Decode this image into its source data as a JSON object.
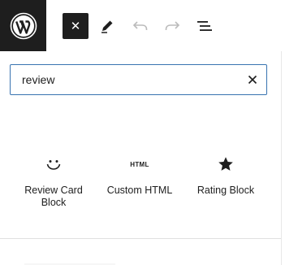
{
  "toolbar": {
    "close_label": "✕",
    "logo_name": "wordpress-logo",
    "icons": [
      "close-icon",
      "pencil-icon",
      "undo-icon",
      "redo-icon",
      "list-view-icon"
    ]
  },
  "search": {
    "value": "review",
    "clear_icon": "close-icon"
  },
  "blocks": [
    {
      "label": "Review Card Block",
      "icon": "smile-icon"
    },
    {
      "label": "Custom HTML",
      "icon_text": "HTML",
      "icon": "html-icon"
    },
    {
      "label": "Rating Block",
      "icon": "star-icon"
    }
  ],
  "colors": {
    "accent": "#3873b0",
    "dark": "#1e1e1e",
    "disabled": "#bbbbbb"
  }
}
